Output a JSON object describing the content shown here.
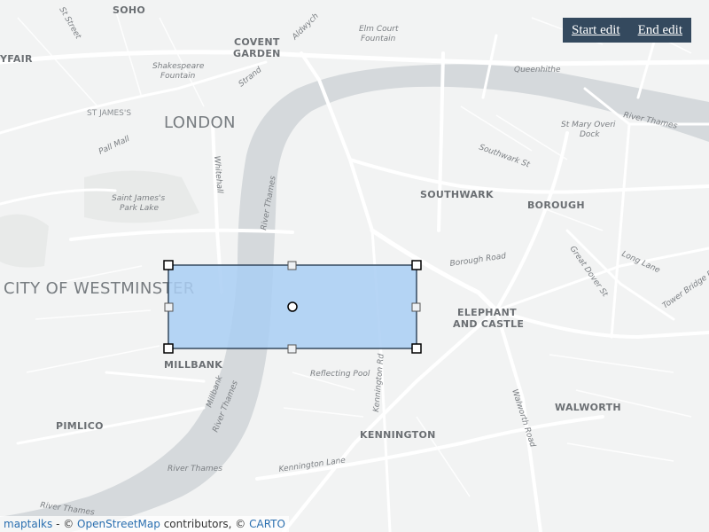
{
  "toolbar": {
    "start_label": "Start edit",
    "end_label": "End edit"
  },
  "attribution": {
    "maptalks": "maptalks",
    "sep1": " - © ",
    "osm": "OpenStreetMap",
    "sep2": " contributors, © ",
    "carto": "CARTO"
  },
  "map_labels": {
    "soho": "SOHO",
    "covent_garden_1": "COVENT",
    "covent_garden_2": "GARDEN",
    "mayfair": "YFAIR",
    "st_james": "ST JAMES'S",
    "london": "LONDON",
    "westminster": "CITY OF WESTMINSTER",
    "millbank": "MILLBANK",
    "pimlico": "PIMLICO",
    "southwark": "SOUTHWARK",
    "borough": "BOROUGH",
    "elephant_1": "ELEPHANT",
    "elephant_2": "AND CASTLE",
    "walworth": "WALWORTH",
    "kennington": "KENNINGTON",
    "shakespeare_1": "Shakespeare",
    "shakespeare_2": "Fountain",
    "elm_court_1": "Elm Court",
    "elm_court_2": "Fountain",
    "queenhithe": "Queenhithe",
    "st_mary_1": "St Mary Overi",
    "st_mary_2": "Dock",
    "st_james_park_1": "Saint James's",
    "st_james_park_2": "Park Lake",
    "reflecting_pool": "Reflecting Pool",
    "river_thames_1": "River Thames",
    "river_thames_2": "River Thames",
    "river_thames_3": "River Thames",
    "river_thames_4": "River Thames",
    "river_thames_5": "River Thames",
    "strand": "Strand",
    "aldwych": "Aldwych",
    "whitehall": "Whitehall",
    "pall_mall": "Pall Mall",
    "borough_road": "Borough Road",
    "southwark_st": "Southwark St",
    "great_dover_st": "Great Dover St",
    "long_lane": "Long Lane",
    "tower_bridge_rd": "Tower Bridge Rd",
    "walworth_road": "Walworth Road",
    "kennington_lane": "Kennington Lane",
    "kennington_rd": "Kennington Rd",
    "millbank_rd": "Millbank",
    "st_streets": "St Street"
  },
  "colors": {
    "water": "#d5d9dc",
    "land": "#f2f3f3",
    "road": "#ffffff",
    "park": "#e6e9e8",
    "rectangle_fill": "#a9cef3",
    "rectangle_stroke": "#34495e",
    "toolbar_bg": "#34495e"
  },
  "drawn_geometry": {
    "type": "rectangle",
    "editing": true,
    "handles": [
      "corner",
      "edge-mid",
      "center"
    ]
  }
}
